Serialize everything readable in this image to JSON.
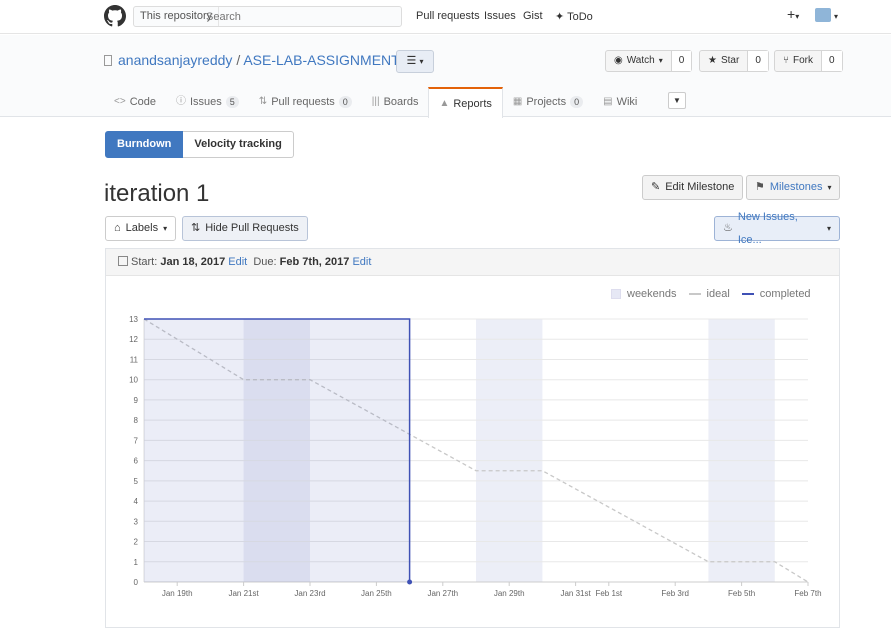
{
  "header": {
    "search_scope": "This repository",
    "search_placeholder": "Search",
    "nav": [
      "Pull requests",
      "Issues",
      "Gist",
      "ToDo"
    ],
    "plus": "+"
  },
  "repo": {
    "owner": "anandsanjayreddy",
    "separator": "/",
    "name": "ASE-LAB-ASSIGNMENTS",
    "list_icon": "☰",
    "watch": {
      "label": "Watch",
      "count": "0"
    },
    "star": {
      "label": "Star",
      "count": "0"
    },
    "fork": {
      "label": "Fork",
      "count": "0"
    }
  },
  "tabs": [
    {
      "icon": "<>",
      "label": "Code",
      "count": ""
    },
    {
      "icon": "ⓘ",
      "label": "Issues",
      "count": "5"
    },
    {
      "icon": "⇅",
      "label": "Pull requests",
      "count": "0"
    },
    {
      "icon": "|||",
      "label": "Boards",
      "count": ""
    },
    {
      "icon": "▲",
      "label": "Reports",
      "count": ""
    },
    {
      "icon": "▦",
      "label": "Projects",
      "count": "0"
    },
    {
      "icon": "▤",
      "label": "Wiki",
      "count": ""
    }
  ],
  "view_toggle": {
    "burndown": "Burndown",
    "velocity": "Velocity tracking"
  },
  "milestone": {
    "title": "iteration 1",
    "edit_label": "Edit Milestone",
    "milestones_label": "Milestones"
  },
  "filters": {
    "labels": "Labels",
    "hide_prs": "Hide Pull Requests",
    "filter": "New Issues, Ice..."
  },
  "dates": {
    "start_label": "Start:",
    "start": "Jan 18, 2017",
    "due_label": "Due:",
    "due": "Feb 7th, 2017",
    "edit": "Edit"
  },
  "legend": {
    "weekends": "weekends",
    "ideal": "ideal",
    "completed": "completed"
  },
  "colors": {
    "accent": "#4078c0",
    "completed": "#3f51b5",
    "ideal": "#c8c8c8",
    "weekend": "#eceef7",
    "tab_active": "#e36209"
  },
  "chart_data": {
    "type": "line",
    "x_range": [
      "Jan 18",
      "Feb 7"
    ],
    "ylim": [
      0,
      13
    ],
    "yticks": [
      0,
      1,
      2,
      3,
      4,
      5,
      6,
      7,
      8,
      9,
      10,
      11,
      12,
      13
    ],
    "xticks": [
      "Jan 19th",
      "Jan 21st",
      "Jan 23rd",
      "Jan 25th",
      "Jan 27th",
      "Jan 29th",
      "Jan 31st",
      "Feb 1st",
      "Feb 3rd",
      "Feb 5th",
      "Feb 7th"
    ],
    "weekends": [
      [
        "Jan 21",
        "Jan 23"
      ],
      [
        "Jan 28",
        "Jan 30"
      ],
      [
        "Feb 4",
        "Feb 6"
      ]
    ],
    "series": [
      {
        "name": "ideal",
        "points": [
          [
            "Jan 18",
            13
          ],
          [
            "Jan 21",
            10
          ],
          [
            "Jan 23",
            10
          ],
          [
            "Jan 28",
            5.5
          ],
          [
            "Jan 30",
            5.5
          ],
          [
            "Feb 4",
            1
          ],
          [
            "Feb 6",
            1
          ],
          [
            "Feb 7",
            0
          ]
        ]
      },
      {
        "name": "completed",
        "points": [
          [
            "Jan 18",
            13
          ],
          [
            "Jan 26",
            13
          ],
          [
            "Jan 26",
            0
          ]
        ]
      }
    ]
  }
}
